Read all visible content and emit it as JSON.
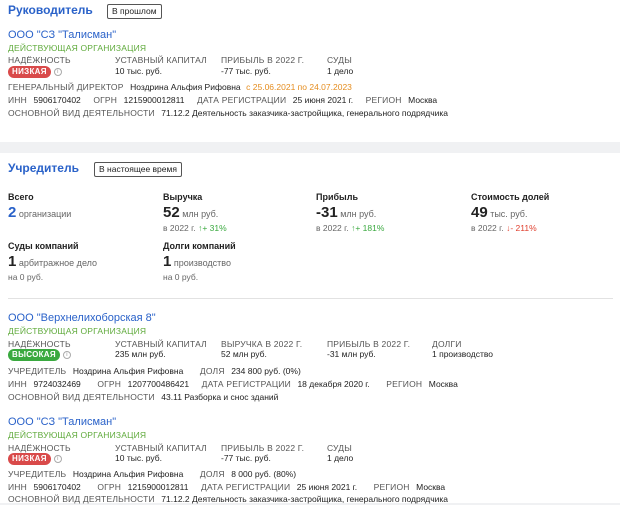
{
  "leader": {
    "title": "Руководитель",
    "tag": "В прошлом",
    "org": {
      "name": "ООО \"СЗ \"Талисман\"",
      "status": "ДЕЙСТВУЮЩАЯ ОРГАНИЗАЦИЯ",
      "reliability_label": "НАДЁЖНОСТЬ",
      "reliability_value": "НИЗКАЯ",
      "capital_label": "УСТАВНЫЙ КАПИТАЛ",
      "capital_value": "10 тыс. руб.",
      "profit_label": "ПРИБЫЛЬ В 2022 Г.",
      "profit_value": "-77 тыс. руб.",
      "courts_label": "СУДЫ",
      "courts_value": "1 дело",
      "director_label": "ГЕНЕРАЛЬНЫЙ ДИРЕКТОР",
      "director_name": "Ноздрина Альфия Рифовна",
      "director_period": "с 25.06.2021 по 24.07.2023",
      "inn_label": "ИНН",
      "inn_value": "5906170402",
      "ogrn_label": "ОГРН",
      "ogrn_value": "1215900012811",
      "reg_label": "ДАТА РЕГИСТРАЦИИ",
      "reg_value": "25 июня 2021 г.",
      "region_label": "РЕГИОН",
      "region_value": "Москва",
      "activity_label": "ОСНОВНОЙ ВИД ДЕЯТЕЛЬНОСТИ",
      "activity_value": "71.12.2 Деятельность заказчика-застройщика, генерального подрядчика"
    }
  },
  "founder": {
    "title": "Учредитель",
    "tag": "В настоящее время",
    "stats": {
      "total_label": "Всего",
      "total_value": "2",
      "total_unit": "организации",
      "revenue_label": "Выручка",
      "revenue_value": "52",
      "revenue_unit": "млн руб.",
      "revenue_year": "в 2022 г.",
      "revenue_change": "+ 31%",
      "profit_label": "Прибыль",
      "profit_value": "-31",
      "profit_unit": "млн руб.",
      "profit_year": "в 2022 г.",
      "profit_change": "+ 181%",
      "shares_label": "Стоимость долей",
      "shares_value": "49",
      "shares_unit": "тыс. руб.",
      "shares_year": "в 2022 г.",
      "shares_change": "- 211%",
      "courts_label": "Суды компаний",
      "courts_value": "1",
      "courts_unit": "арбитражное дело",
      "courts_sum": "на 0 руб.",
      "debts_label": "Долги компаний",
      "debts_value": "1",
      "debts_unit": "производство",
      "debts_sum": "на 0 руб."
    },
    "orgs": [
      {
        "name": "ООО \"Верхнелихоборская 8\"",
        "status": "ДЕЙСТВУЮЩАЯ ОРГАНИЗАЦИЯ",
        "reliability_label": "НАДЁЖНОСТЬ",
        "reliability_value": "ВЫСОКАЯ",
        "capital_label": "УСТАВНЫЙ КАПИТАЛ",
        "capital_value": "235 млн руб.",
        "c3_label": "ВЫРУЧКА В 2022 Г.",
        "c3_value": "52 млн руб.",
        "c4_label": "ПРИБЫЛЬ В 2022 Г.",
        "c4_value": "-31 млн руб.",
        "c5_label": "ДОЛГИ",
        "c5_value": "1 производство",
        "founder_label": "УЧРЕДИТЕЛЬ",
        "founder_name": "Ноздрина Альфия Рифовна",
        "share_label": "ДОЛЯ",
        "share_value": "234 800 руб. (0%)",
        "inn_label": "ИНН",
        "inn_value": "9724032469",
        "ogrn_label": "ОГРН",
        "ogrn_value": "1207700486421",
        "reg_label": "ДАТА РЕГИСТРАЦИИ",
        "reg_value": "18 декабря 2020 г.",
        "region_label": "РЕГИОН",
        "region_value": "Москва",
        "activity_label": "ОСНОВНОЙ ВИД ДЕЯТЕЛЬНОСТИ",
        "activity_value": "43.11 Разборка и снос зданий"
      },
      {
        "name": "ООО \"СЗ \"Талисман\"",
        "status": "ДЕЙСТВУЮЩАЯ ОРГАНИЗАЦИЯ",
        "reliability_label": "НАДЁЖНОСТЬ",
        "reliability_value": "НИЗКАЯ",
        "capital_label": "УСТАВНЫЙ КАПИТАЛ",
        "capital_value": "10 тыс. руб.",
        "c3_label": "ПРИБЫЛЬ В 2022 Г.",
        "c3_value": "-77 тыс. руб.",
        "c4_label": "СУДЫ",
        "c4_value": "1 дело",
        "founder_label": "УЧРЕДИТЕЛЬ",
        "founder_name": "Ноздрина Альфия Рифовна",
        "share_label": "ДОЛЯ",
        "share_value": "8 000 руб. (80%)",
        "inn_label": "ИНН",
        "inn_value": "5906170402",
        "ogrn_label": "ОГРН",
        "ogrn_value": "1215900012811",
        "reg_label": "ДАТА РЕГИСТРАЦИИ",
        "reg_value": "25 июня 2021 г.",
        "region_label": "РЕГИОН",
        "region_value": "Москва",
        "activity_label": "ОСНОВНОЙ ВИД ДЕЯТЕЛЬНОСТИ",
        "activity_value": "71.12.2 Деятельность заказчика-застройщика, генерального подрядчика"
      }
    ]
  },
  "colors": {
    "accent": "#2a62c9",
    "active": "#5faa3b",
    "low": "#d94a4a",
    "high": "#3aa93f",
    "warning": "#e58d1f"
  },
  "icons": {
    "info": "info-icon",
    "arrow_up": "arrow-up-icon",
    "arrow_down": "arrow-down-icon"
  }
}
